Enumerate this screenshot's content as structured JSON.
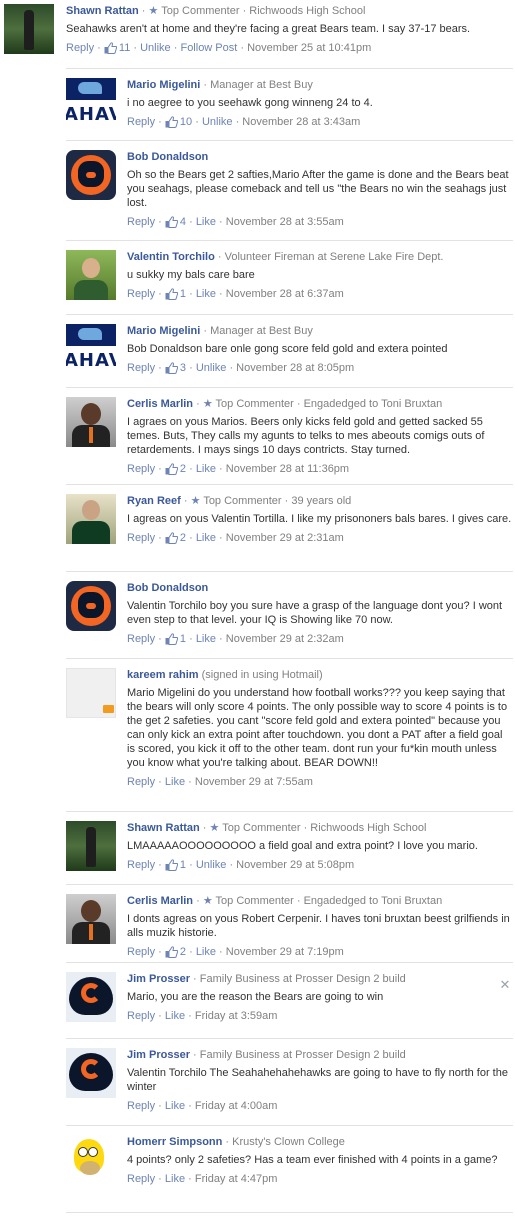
{
  "labels": {
    "reply": "Reply",
    "like": "Like",
    "unlike": "Unlike",
    "follow_post": "Follow Post",
    "sep": " · "
  },
  "comments": [
    {
      "name": "Shawn Rattan",
      "avatar": "field-player-photo",
      "badge": "Top Commenter",
      "meta": "Richwoods High School",
      "text": "Seahawks aren't at home and they're facing a great Bears team. I say 37-17 bears.",
      "likes": "11",
      "like_action": "Unlike",
      "follow": "Follow Post",
      "time": "November 25 at 10:41pm"
    },
    {
      "name": "Mario Migelini",
      "avatar": "seahawks-logo",
      "badge": "",
      "meta": "Manager at Best Buy",
      "text": "i no aegree to you seehawk gong winneng 24 to 4.",
      "likes": "10",
      "like_action": "Unlike",
      "time": "November 28 at 3:43am"
    },
    {
      "name": "Bob Donaldson",
      "avatar": "bears-logo",
      "badge": "",
      "meta": "",
      "text": "Oh so the Bears get 2 safties,Mario After the game is done and the Bears beat you seahags, please comeback and tell us \"the Bears no win the seahags just lost.",
      "likes": "4",
      "like_action": "Like",
      "time": "November 28 at 3:55am"
    },
    {
      "name": "Valentin Torchilo",
      "avatar": "man-green-background-photo",
      "badge": "",
      "meta": "Volunteer Fireman at Serene Lake Fire Dept.",
      "text": "u sukky my bals care bare",
      "likes": "1",
      "like_action": "Like",
      "time": "November 28 at 6:37am"
    },
    {
      "name": "Mario Migelini",
      "avatar": "seahawks-logo",
      "badge": "",
      "meta": "Manager at Best Buy",
      "text": "Bob Donaldson bare onle gong score feld gold and extera pointed",
      "likes": "3",
      "like_action": "Unlike",
      "time": "November 28 at 8:05pm"
    },
    {
      "name": "Cerlis Marlin",
      "avatar": "man-suit-photo",
      "badge": "Top Commenter",
      "meta": "Engadedged to Toni Bruxtan",
      "text": "I agraes on yous Marios. Beers only kicks feld gold and getted sacked 55 temes. Buts, They calls my agunts to telks to mes abeouts comigs outs of retardements. I mays sings 10 days contricts. Stay turned.",
      "likes": "2",
      "like_action": "Like",
      "time": "November 28 at 11:36pm"
    },
    {
      "name": "Ryan Reef",
      "avatar": "man-jersey-photo",
      "badge": "Top Commenter",
      "meta": "39 years old",
      "text": "I agreas on yous Valentin Tortilla. I like my prisononers bals bares. I gives care.",
      "likes": "2",
      "like_action": "Like",
      "time": "November 29 at 2:31am"
    },
    {
      "name": "Bob Donaldson",
      "avatar": "bears-logo",
      "badge": "",
      "meta": "",
      "text": "Valentin Torchilo boy you sure have a grasp of the language dont you? I wont even step to that level. your IQ is Showing like 70 now.",
      "likes": "1",
      "like_action": "Like",
      "time": "November 29 at 2:32am"
    },
    {
      "name": "kareem rahim",
      "avatar": "default-hotmail-avatar",
      "badge": "",
      "meta": "(signed in using Hotmail)",
      "text": "Mario Migelini do you understand how football works??? you keep saying that the bears will only score 4 points. The only possible way to score 4 points is to the get 2 safeties. you cant \"score feld gold and extera pointed\" because you can only kick an extra point after touchdown. you dont a PAT after a field goal is scored, you kick it off to the other team. dont run your fu*kin mouth unless you know what you're talking about. BEAR DOWN!!",
      "likes": "",
      "like_action": "Like",
      "time": "November 29 at 7:55am"
    },
    {
      "name": "Shawn Rattan",
      "avatar": "field-player-photo",
      "badge": "Top Commenter",
      "meta": "Richwoods High School",
      "text": "LMAAAAAOOOOOOOOO a field goal and extra point? I love you mario.",
      "likes": "1",
      "like_action": "Unlike",
      "time": "November 29 at 5:08pm"
    },
    {
      "name": "Cerlis Marlin",
      "avatar": "man-suit-photo",
      "badge": "Top Commenter",
      "meta": "Engadedged to Toni Bruxtan",
      "text": "I donts agreas on yous Robert Cerpenir. I haves toni bruxtan beest grilfiends in alls muzik historie.",
      "likes": "2",
      "like_action": "Like",
      "time": "November 29 at 7:19pm"
    },
    {
      "name": "Jim Prosser",
      "avatar": "bears-helmet-photo",
      "badge": "",
      "meta": "Family Business at Prosser Design 2 build",
      "text": "Mario, you are the reason the Bears are going to win",
      "likes": "",
      "like_action": "Like",
      "time": "Friday at 3:59am"
    },
    {
      "name": "Jim Prosser",
      "avatar": "bears-helmet-photo",
      "badge": "",
      "meta": "Family Business at Prosser Design 2 build",
      "text": "Valentin Torchilo The Seahahehahehawks are going to have to fly north for the winter",
      "likes": "",
      "like_action": "Like",
      "time": "Friday at 4:00am"
    },
    {
      "name": "Homerr Simpsonn",
      "avatar": "homer-simpson-avatar",
      "badge": "",
      "meta": "Krusty's Clown College",
      "text": "4 points? only 2 safeties? Has a team ever finished with 4 points in a game?",
      "likes": "",
      "like_action": "Like",
      "time": "Friday at 4:47pm"
    }
  ],
  "colors": {
    "link": "#3b5998",
    "action": "#6d84b4",
    "meta": "#808080"
  }
}
